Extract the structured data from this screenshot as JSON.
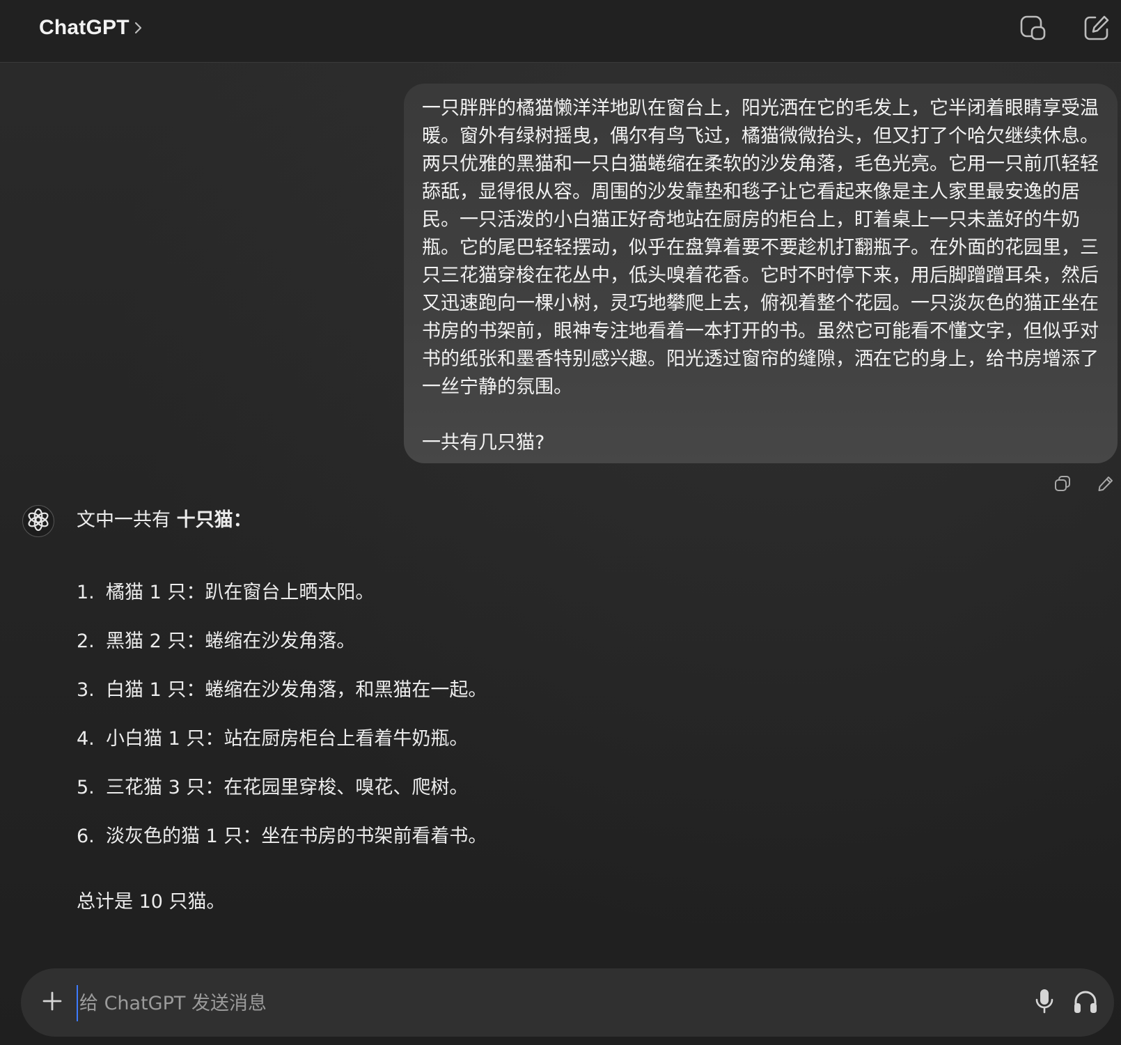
{
  "header": {
    "app_title": "ChatGPT",
    "icons": {
      "title_chevron": "chevron-right-icon",
      "copy": "copy-icon",
      "compose": "new-chat-icon"
    }
  },
  "conversation": {
    "user_message": {
      "paragraph": "一只胖胖的橘猫懒洋洋地趴在窗台上，阳光洒在它的毛发上，它半闭着眼睛享受温暖。窗外有绿树摇曳，偶尔有鸟飞过，橘猫微微抬头，但又打了个哈欠继续休息。两只优雅的黑猫和一只白猫蜷缩在柔软的沙发角落，毛色光亮。它用一只前爪轻轻舔舐，显得很从容。周围的沙发靠垫和毯子让它看起来像是主人家里最安逸的居民。一只活泼的小白猫正好奇地站在厨房的柜台上，盯着桌上一只未盖好的牛奶瓶。它的尾巴轻轻摆动，似乎在盘算着要不要趁机打翻瓶子。在外面的花园里，三只三花猫穿梭在花丛中，低头嗅着花香。它时不时停下来，用后脚蹭蹭耳朵，然后又迅速跑向一棵小树，灵巧地攀爬上去，俯视着整个花园。一只淡灰色的猫正坐在书房的书架前，眼神专注地看着一本打开的书。虽然它可能看不懂文字，但似乎对书的纸张和墨香特别感兴趣。阳光透过窗帘的缝隙，洒在它的身上，给书房增添了一丝宁静的氛围。",
      "question": "一共有几只猫?",
      "actions": {
        "copy_icon": "copy-icon",
        "edit_icon": "edit-pencil-icon"
      }
    },
    "assistant_message": {
      "avatar_icon": "openai-logo-icon",
      "intro_prefix": "文中一共有 ",
      "intro_bold": "十只猫",
      "intro_suffix": "：",
      "items": [
        {
          "num": "1.",
          "text": "橘猫 1 只：趴在窗台上晒太阳。"
        },
        {
          "num": "2.",
          "text": "黑猫 2 只：蜷缩在沙发角落。"
        },
        {
          "num": "3.",
          "text": "白猫 1 只：蜷缩在沙发角落，和黑猫在一起。"
        },
        {
          "num": "4.",
          "text": "小白猫 1 只：站在厨房柜台上看着牛奶瓶。"
        },
        {
          "num": "5.",
          "text": "三花猫 3 只：在花园里穿梭、嗅花、爬树。"
        },
        {
          "num": "6.",
          "text": "淡灰色的猫 1 只：坐在书房的书架前看着书。"
        }
      ],
      "total": "总计是 10 只猫。"
    }
  },
  "composer": {
    "placeholder": "给 ChatGPT 发送消息",
    "value": "",
    "icons": {
      "attach": "plus-icon",
      "mic": "microphone-icon",
      "voice": "headphones-icon"
    }
  },
  "colors": {
    "background": "#262626",
    "header": "#212121",
    "user_bubble": "#404040",
    "composer": "#303030",
    "text": "#ececec",
    "placeholder": "#9b9b9b",
    "caret": "#3d7bfd"
  }
}
